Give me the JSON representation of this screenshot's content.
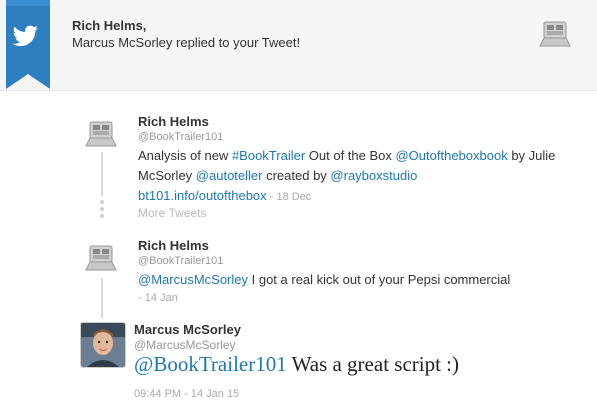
{
  "notification": {
    "recipient": "Rich Helms,",
    "message": "Marcus McSorley replied to your Tweet!",
    "ribbon_icon": "twitter-bird-icon",
    "logo_icon": "booktrailer-logo-icon"
  },
  "tweet1": {
    "name": "Rich Helms",
    "handle": "@BookTrailer101",
    "text_prefix": "Analysis of new ",
    "hashtag": "#BookTrailer",
    "text_mid1": " Out of the Box ",
    "mention1": "@Outoftheboxbook",
    "text_mid2": " by Julie McSorley ",
    "mention2": "@autoteller",
    "text_mid3": " created by ",
    "mention3": "@rayboxstudio",
    "link": "bt101.info/outofthebox",
    "time": " - 18 Dec",
    "more": "More Tweets"
  },
  "tweet2": {
    "name": "Rich Helms",
    "handle": "@BookTrailer101",
    "mention": "@MarcusMcSorley",
    "text": " I got a real kick out of your Pepsi commercial",
    "time": "- 14 Jan"
  },
  "reply": {
    "name": "Marcus McSorley",
    "handle": "@MarcusMcSorley",
    "mention": "@BookTrailer101",
    "text": " Was a great script :)",
    "time": "09:44 PM - 14 Jan 15"
  },
  "colors": {
    "ribbon": "#2e7fc0",
    "link": "#1e78b4",
    "header_bg": "#f5f5f5"
  }
}
